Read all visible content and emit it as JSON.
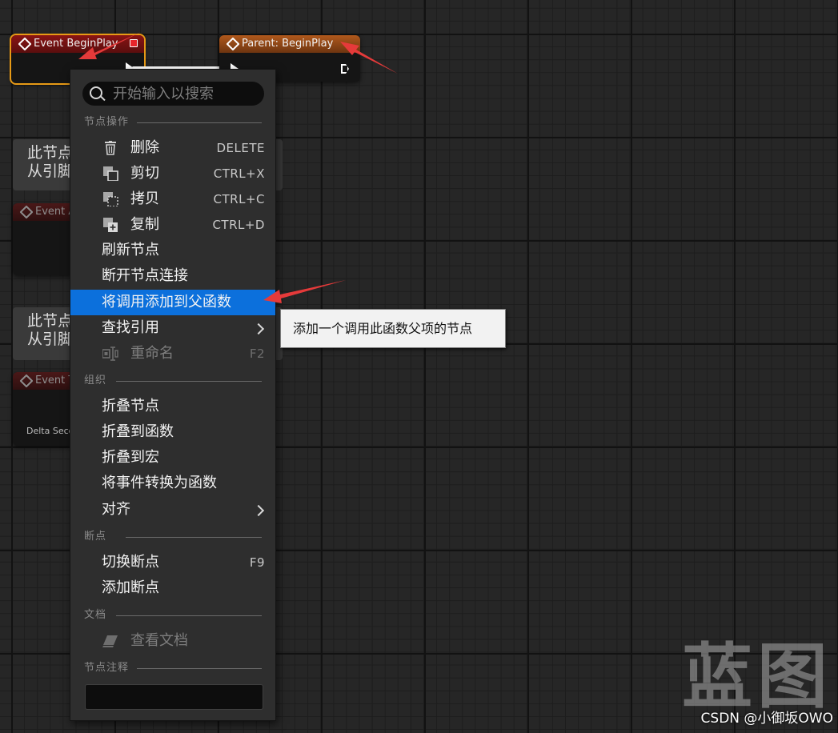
{
  "nodes": {
    "event_beginplay": {
      "title": "Event BeginPlay"
    },
    "parent_beginplay": {
      "title": "Parent: BeginPlay"
    },
    "comment_1": {
      "line1": "此节点",
      "line2": "从引脚"
    },
    "comment_2": {
      "line1": "此节点",
      "line2": "从引脚"
    },
    "event_a": {
      "title": "Event A"
    },
    "event_t": {
      "title": "Event T"
    },
    "delta_label": "Delta Seco"
  },
  "menu": {
    "search_placeholder": "开始输入以搜索",
    "sections": {
      "node_ops": "节点操作",
      "organize": "组织",
      "breakpoints": "断点",
      "docs": "文档",
      "node_comment": "节点注释"
    },
    "items": {
      "delete": {
        "label": "删除",
        "shortcut": "DELETE"
      },
      "cut": {
        "label": "剪切",
        "shortcut": "CTRL+X"
      },
      "copy": {
        "label": "拷贝",
        "shortcut": "CTRL+C"
      },
      "duplicate": {
        "label": "复制",
        "shortcut": "CTRL+D"
      },
      "refresh": {
        "label": "刷新节点"
      },
      "break_links": {
        "label": "断开节点连接"
      },
      "add_parent_call": {
        "label": "将调用添加到父函数"
      },
      "find_refs": {
        "label": "查找引用"
      },
      "rename": {
        "label": "重命名",
        "shortcut": "F2"
      },
      "collapse_nodes": {
        "label": "折叠节点"
      },
      "collapse_function": {
        "label": "折叠到函数"
      },
      "collapse_macro": {
        "label": "折叠到宏"
      },
      "convert_event": {
        "label": "将事件转换为函数"
      },
      "align": {
        "label": "对齐"
      },
      "toggle_breakpoint": {
        "label": "切换断点",
        "shortcut": "F9"
      },
      "add_breakpoint": {
        "label": "添加断点"
      },
      "view_docs": {
        "label": "查看文档"
      }
    },
    "comment_value": ""
  },
  "tooltip": "添加一个调用此函数父项的节点",
  "watermark": "蓝图",
  "credit": "CSDN @小御坂OWO",
  "colors": {
    "highlight": "#0c70dc",
    "event_header": "#8a1414",
    "parent_header": "#b0591c",
    "selection": "#e79a16",
    "arrow": "#e53a3a"
  }
}
